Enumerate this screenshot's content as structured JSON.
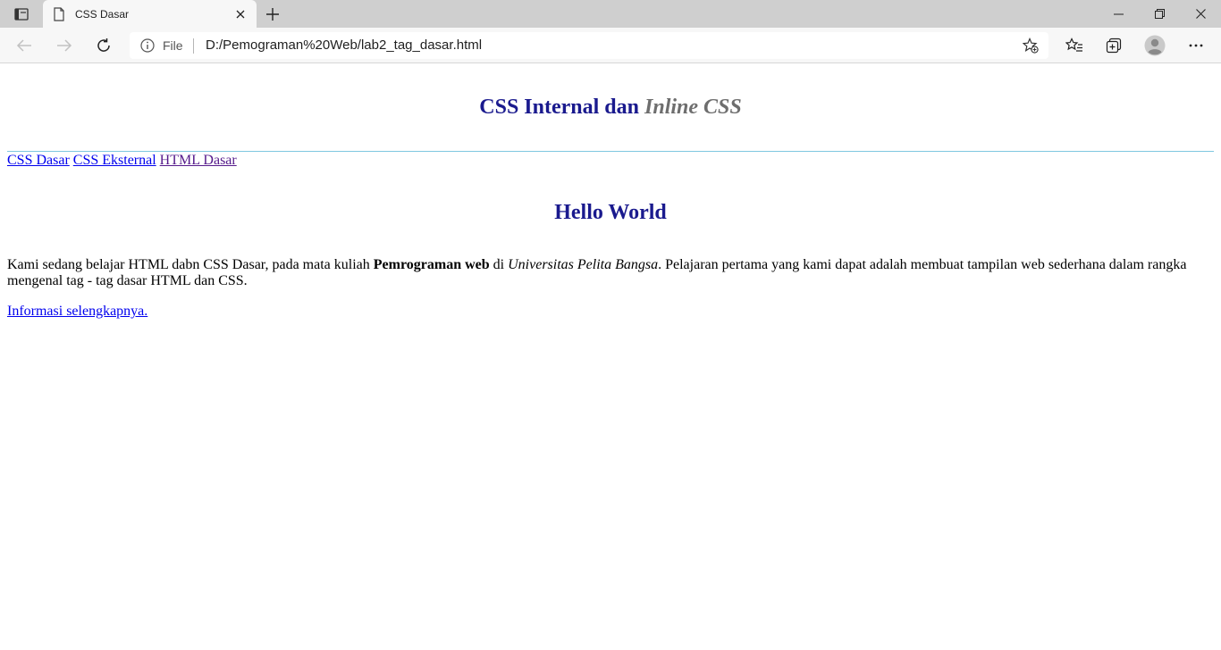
{
  "browser": {
    "tab": {
      "title": "CSS Dasar"
    },
    "address": {
      "scheme_label": "File",
      "url": "D:/Pemograman%20Web/lab2_tag_dasar.html"
    },
    "icons": [
      "tab-actions-icon",
      "document-icon",
      "close-icon",
      "plus-icon",
      "minimize-icon",
      "restore-icon",
      "close-window-icon",
      "back-arrow-icon",
      "forward-arrow-icon",
      "reload-icon",
      "info-icon",
      "add-favorite-icon",
      "favorites-icon",
      "collections-icon",
      "profile-icon",
      "more-icon"
    ]
  },
  "page": {
    "title_normal": "CSS Internal dan ",
    "title_italic": "Inline CSS",
    "nav_links": [
      "CSS Dasar",
      "CSS Eksternal",
      "HTML Dasar"
    ],
    "heading": "Hello World",
    "paragraph": {
      "part1": "Kami sedang belajar HTML dabn CSS Dasar, pada mata kuliah ",
      "bold": "Pemrograman web",
      "part2": " di ",
      "italic": "Universitas Pelita Bangsa",
      "part3": ". Pelajaran pertama yang kami dapat adalah membuat tampilan web sederhana dalam rangka mengenal tag - tag dasar HTML dan CSS."
    },
    "more_link": "Informasi selengkapnya."
  },
  "colors": {
    "heading": "#1a1a8e",
    "italic_title": "#6e6e6e",
    "link": "#0000ee",
    "visited_link": "#551a8b",
    "divider": "#7fc7e0"
  }
}
